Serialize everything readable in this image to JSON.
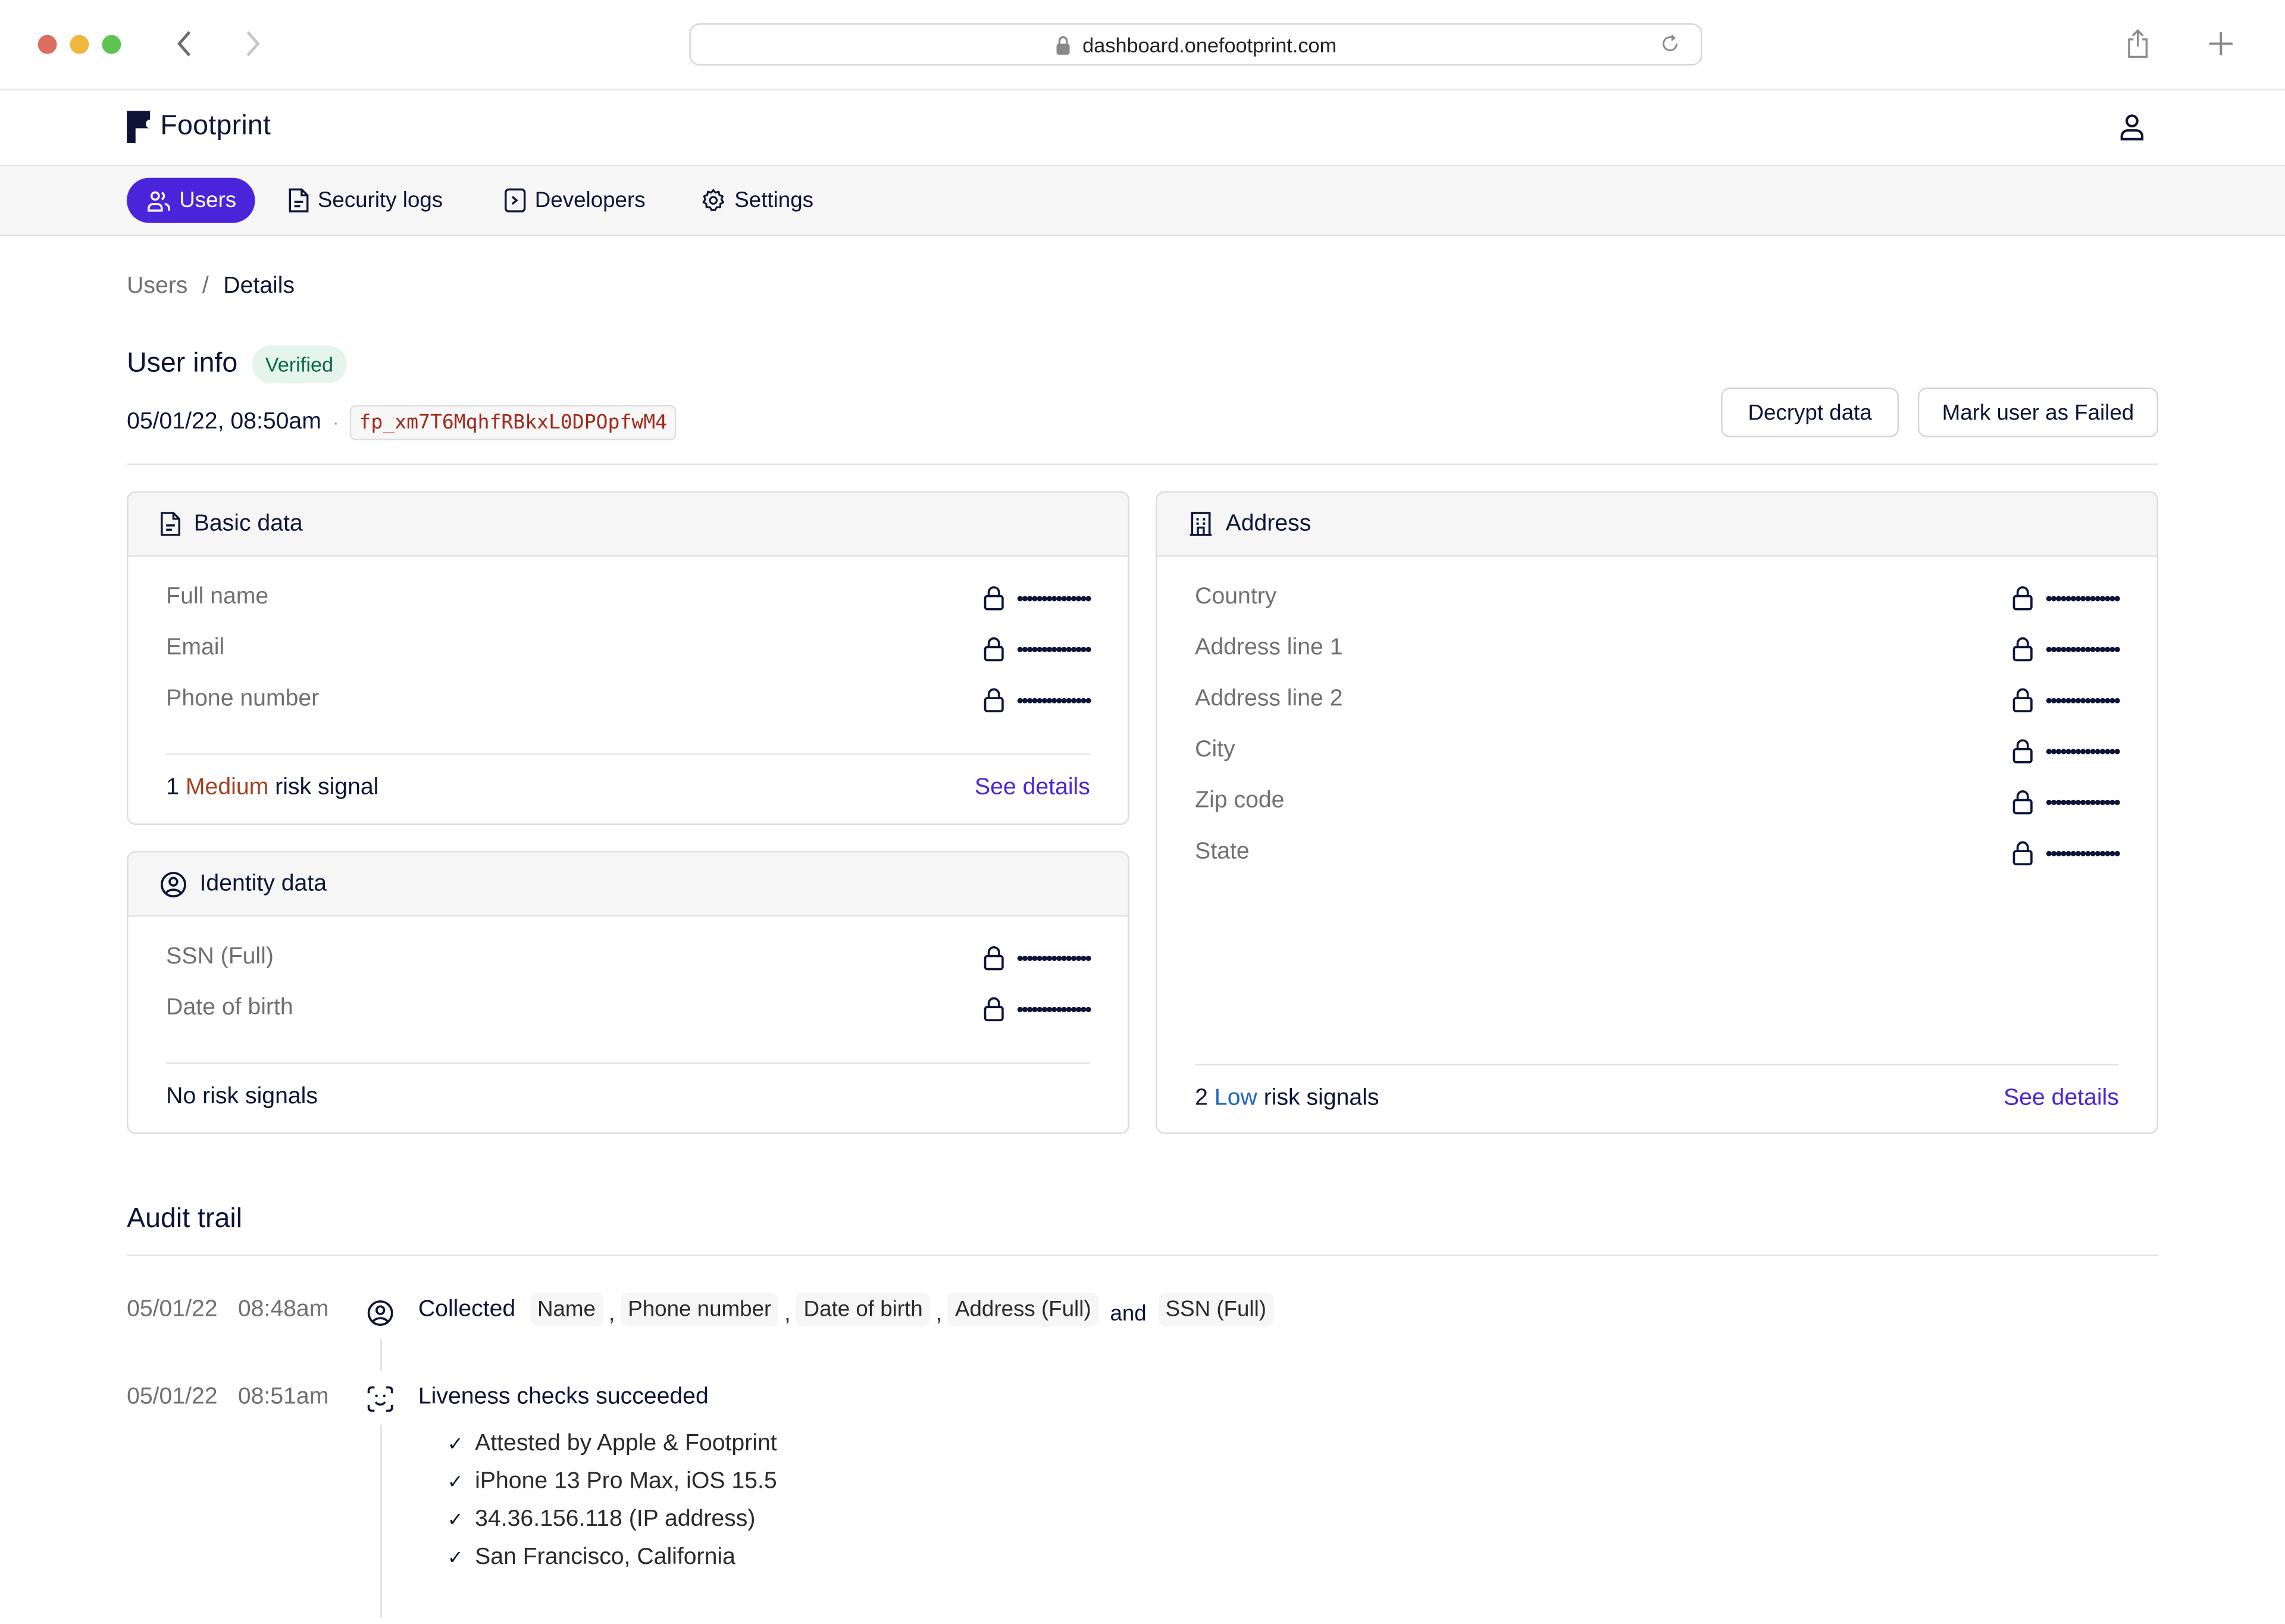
{
  "browser": {
    "url": "dashboard.onefootprint.com",
    "icons": {
      "back": "chevron-left-icon",
      "forward": "chevron-right-icon",
      "lock": "lock-icon",
      "reload": "reload-icon",
      "share": "share-icon",
      "new_tab": "plus-icon"
    },
    "traffic_lights": [
      "#dd6d5e",
      "#f0b73d",
      "#5fc453"
    ]
  },
  "app": {
    "brand": "Footprint",
    "brand_color": "#0e1438",
    "accent_color": "#4a24db",
    "account_icon": "user-icon"
  },
  "nav": {
    "items": [
      {
        "label": "Users",
        "icon": "users-icon",
        "active": true
      },
      {
        "label": "Security logs",
        "icon": "file-icon",
        "active": false
      },
      {
        "label": "Developers",
        "icon": "terminal-icon",
        "active": false
      },
      {
        "label": "Settings",
        "icon": "gear-icon",
        "active": false
      }
    ]
  },
  "breadcrumb": {
    "parent": "Users",
    "separator": "/",
    "current": "Details"
  },
  "user_info": {
    "title": "User info",
    "status": "Verified",
    "timestamp": "05/01/22, 08:50am",
    "separator": "·",
    "user_id": "fp_xm7T6MqhfRBkxL0DPOpfwM4",
    "actions": {
      "decrypt": "Decrypt data",
      "mark_failed": "Mark user as Failed"
    }
  },
  "cards": {
    "basic": {
      "title": "Basic data",
      "fields": [
        {
          "label": "Full name",
          "value": "•••••••••••••••"
        },
        {
          "label": "Email",
          "value": "•••••••••••••••"
        },
        {
          "label": "Phone number",
          "value": "•••••••••••••••"
        }
      ],
      "risk": {
        "count": "1",
        "level": "Medium",
        "suffix": "risk signal"
      },
      "link": "See details"
    },
    "identity": {
      "title": "Identity data",
      "fields": [
        {
          "label": "SSN (Full)",
          "value": "•••••••••••••••"
        },
        {
          "label": "Date of birth",
          "value": "•••••••••••••••"
        }
      ],
      "risk_text": "No risk signals"
    },
    "address": {
      "title": "Address",
      "fields": [
        {
          "label": "Country",
          "value": "•••••••••••••••"
        },
        {
          "label": "Address line 1",
          "value": "•••••••••••••••"
        },
        {
          "label": "Address line 2",
          "value": "•••••••••••••••"
        },
        {
          "label": "City",
          "value": "•••••••••••••••"
        },
        {
          "label": "Zip code",
          "value": "•••••••••••••••"
        },
        {
          "label": "State",
          "value": "•••••••••••••••"
        }
      ],
      "risk": {
        "count": "2",
        "level": "Low",
        "suffix": "risk signals"
      },
      "link": "See details"
    }
  },
  "audit": {
    "title": "Audit trail",
    "events": [
      {
        "date": "05/01/22",
        "time": "08:48am",
        "icon": "user-circle-icon",
        "title": "Collected",
        "chips": [
          "Name",
          "Phone number",
          "Date of birth",
          "Address (Full)",
          "SSN (Full)"
        ],
        "comma": ",",
        "and": "and"
      },
      {
        "date": "05/01/22",
        "time": "08:51am",
        "icon": "face-id-icon",
        "title": "Liveness checks succeeded",
        "checks": [
          "Attested by Apple & Footprint",
          "iPhone 13 Pro Max, iOS 15.5",
          "34.36.156.118 (IP address)",
          "San Francisco, California"
        ]
      }
    ]
  }
}
